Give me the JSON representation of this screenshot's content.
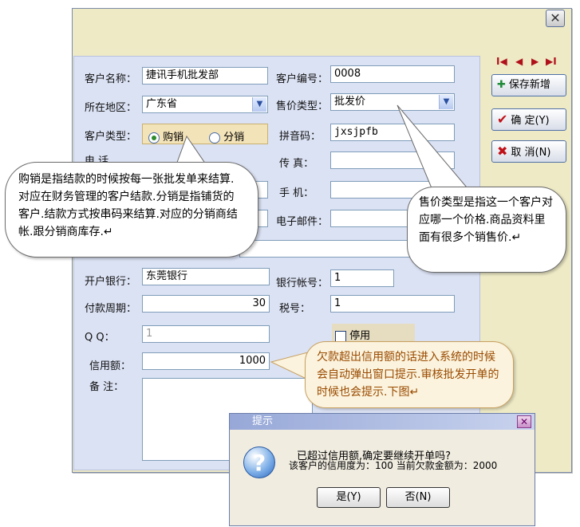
{
  "form": {
    "customer_name_label": "客户名称：",
    "customer_name_value": "捷讯手机批发部",
    "customer_no_label": "客户编号：",
    "customer_no_value": "0008",
    "region_label": "所在地区：",
    "region_value": "广东省",
    "price_type_label": "售价类型：",
    "price_type_value": "批发价",
    "customer_type_label": "客户类型：",
    "customer_type_options": [
      "购销",
      "分销"
    ],
    "pinyin_label": "拼音码：",
    "pinyin_value": "jxsjpfb",
    "phone_label_partial": "电    话",
    "fax_label": "传    真：",
    "mobile_label": "手    机：",
    "email_label": "电子邮件：",
    "bank_label": "开户银行：",
    "bank_value": "东莞银行",
    "bank_account_label": "银行帐号：",
    "bank_account_value": "1",
    "pay_period_label": "付款周期：",
    "pay_period_value": "30",
    "tax_no_label": "税号：",
    "tax_no_value": "1",
    "qq_label": "Q      Q：",
    "qq_value": "1",
    "disabled_label": "停用",
    "credit_label": "信用额：",
    "credit_value": "1000",
    "note_label": "备      注："
  },
  "side": {
    "nav": [
      "I◀",
      "◀",
      "▶",
      "▶I"
    ],
    "save_new_label": "保存新增",
    "ok_label": "确  定(Y)",
    "cancel_label": "取  消(N)"
  },
  "bubbles": {
    "customer_type_note": "购销是指结款的时候按每一张批发单来结算.对应在财务管理的客户结款.分销是指铺货的客户.结款方式按串码来结算.对应的分销商结帐.跟分销商库存.↵",
    "price_type_note": "售价类型是指这一个客户对应哪一个价格.商品资料里面有很多个销售价.↵",
    "credit_note": "欠款超出信用额的话进入系统的时候会自动弹出窗口提示.审核批发开单的时候也会提示.下图↵"
  },
  "popup": {
    "title": "提示",
    "line1": "已超过信用额,确定要继续开单吗?",
    "line2": "该客户的信用度为：100  当前欠款金额为：2000",
    "yes_label": "是(Y)",
    "no_label": "否(N)"
  },
  "colors": {
    "dialog_bg": "#eeeac6",
    "panel_bg": "#dbe2f4",
    "credit_note_text": "#9a4a00"
  },
  "icons": {
    "close": "close-icon",
    "save": "plus-icon",
    "ok": "checkmark-icon",
    "cancel": "x-icon",
    "question": "question-icon"
  }
}
